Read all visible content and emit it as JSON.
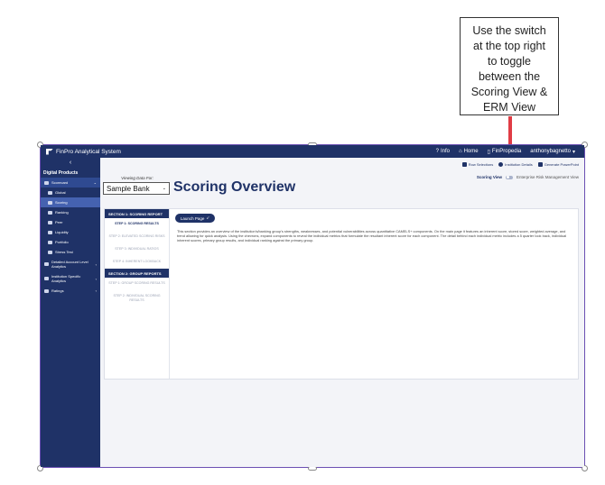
{
  "callout": {
    "lines": [
      "Use the switch",
      "at the top right",
      "to toggle",
      "between the",
      "Scoring View &",
      "ERM View"
    ]
  },
  "topbar": {
    "app_name": "FinPro Analytical System",
    "info": "Info",
    "home": "Home",
    "finpropedia": "FinPropedia",
    "user": "anthonybagnetto"
  },
  "sidebar": {
    "section": "Digital Products",
    "items": [
      {
        "label": "Scorecard"
      },
      {
        "label": "Global"
      },
      {
        "label": "Scoring"
      },
      {
        "label": "Ranking"
      },
      {
        "label": "Peer"
      },
      {
        "label": "Liquidity"
      },
      {
        "label": "Portfolio"
      },
      {
        "label": "Stress Test"
      },
      {
        "label": "Detailed Account Level Analytics"
      },
      {
        "label": "Institution Specific Analytics"
      },
      {
        "label": "Ratings"
      }
    ]
  },
  "actions": {
    "row_selections": "Row Selections",
    "institution_details": "Institution Details",
    "generate_powerpoint": "Generate PowerPoint"
  },
  "viewing": {
    "label": "Viewing Data For:",
    "selected": "Sample Bank"
  },
  "page": {
    "title": "Scoring Overview",
    "scoring_view": "Scoring View",
    "erm_view": "Enterprise Risk Management View",
    "launch": "Launch Page"
  },
  "steps": {
    "section1": "SECTION 1: SCORING REPORT",
    "s1": "STEP 1: SCORING RESULTS",
    "s2": "STEP 2: ELEVATED SCORING RISKS",
    "s3": "STEP 3: INDIVIDUAL RATIOS",
    "s4": "STEP 4: INHERENT LOOKBACK",
    "section2": "SECTION 2: GROUP REPORTS",
    "g1": "STEP 1: GROUP SCORING RESULTS",
    "g2": "STEP 2: INDIVIDUAL SCORING RESULTS"
  },
  "description": "This section provides an overview of the institution's/banking group's strengths, weaknesses, and potential vulnerabilities across quantitative CAMELS+ components. On the main page it features an inherent score, stored score, weighted average, and trend allowing for quick analysis. Using the chevrons, expand components to reveal the individual metrics that formulate the resultant inherent score for each component. The detail behind each individual metric includes a 5 quarter look back, individual inherent scores, primary group results, and individual ranking against the primary group.",
  "colors": {
    "navy": "#1f3267",
    "arrow": "#e03c45",
    "frame": "#6b4fb3"
  }
}
